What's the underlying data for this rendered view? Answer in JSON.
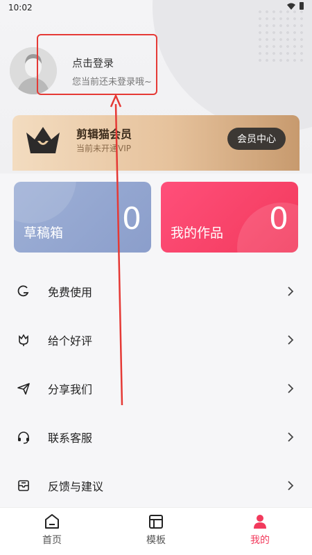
{
  "status_bar": {
    "time": "10:02"
  },
  "profile": {
    "login_title": "点击登录",
    "login_subtitle": "您当前还未登录哦~"
  },
  "vip": {
    "title": "剪辑猫会员",
    "subtitle": "当前未开通VIP",
    "button": "会员中心"
  },
  "stats": [
    {
      "label": "草稿箱",
      "count": "0"
    },
    {
      "label": "我的作品",
      "count": "0"
    }
  ],
  "menu": [
    {
      "label": "免费使用",
      "icon": "g-letter-icon"
    },
    {
      "label": "给个好评",
      "icon": "flower-icon"
    },
    {
      "label": "分享我们",
      "icon": "paper-plane-icon"
    },
    {
      "label": "联系客服",
      "icon": "headset-icon"
    },
    {
      "label": "反馈与建议",
      "icon": "feedback-icon"
    }
  ],
  "tabs": [
    {
      "label": "首页",
      "icon": "home-icon",
      "active": false
    },
    {
      "label": "模板",
      "icon": "template-icon",
      "active": false
    },
    {
      "label": "我的",
      "icon": "profile-icon",
      "active": true
    }
  ],
  "colors": {
    "accent": "#f23a5c",
    "annotation": "#e53935",
    "drafts_card": "#8b9ecb",
    "works_card": "#f23a5c"
  }
}
